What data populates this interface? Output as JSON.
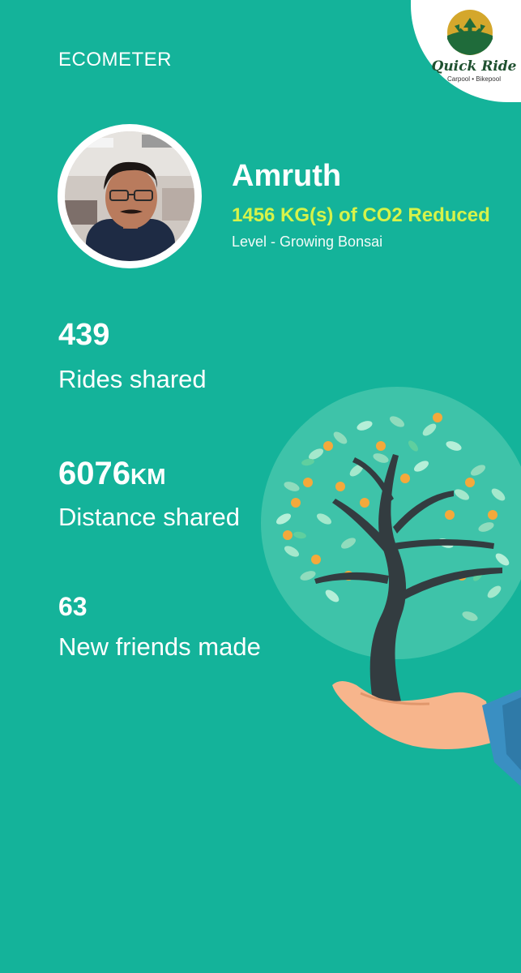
{
  "header": {
    "title": "ECOMETER"
  },
  "brand": {
    "name": "Quick Ride",
    "tagline": "Carpool • Bikepool"
  },
  "profile": {
    "name": "Amruth",
    "co2": "1456 KG(s) of CO2 Reduced",
    "level": "Level - Growing Bonsai"
  },
  "stats": {
    "rides": {
      "value": "439",
      "label": "Rides shared"
    },
    "distance": {
      "value": "6076",
      "unit": "KM",
      "label": "Distance shared"
    },
    "friends": {
      "value": "63",
      "label": "New friends made"
    }
  },
  "colors": {
    "background": "#14b39a",
    "accent": "#d6f34a",
    "brand_green": "#1f5130"
  }
}
